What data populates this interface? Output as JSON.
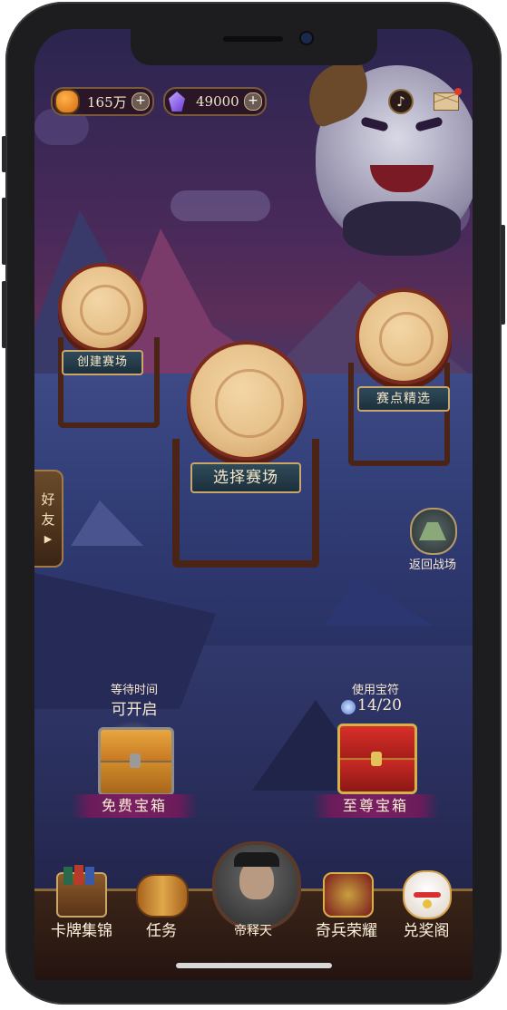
{
  "resources": {
    "coins": "165万",
    "gems": "49000"
  },
  "drums": {
    "create_label": "创建赛场",
    "select_label": "选择赛场",
    "featured_label": "赛点精选"
  },
  "side": {
    "friend_label": "好友",
    "friend_arrow": "▶",
    "return_label": "返回战场"
  },
  "free_chest": {
    "wait_label": "等待时间",
    "status": "可开启",
    "name": "免费宝箱"
  },
  "premium_chest": {
    "use_label": "使用宝符",
    "count": "14/20",
    "name": "至尊宝箱"
  },
  "nav": {
    "items": [
      {
        "label": "卡牌集锦"
      },
      {
        "label": "任务"
      },
      {
        "label": "帝释天"
      },
      {
        "label": "奇兵荣耀"
      },
      {
        "label": "兑奖阁"
      }
    ]
  },
  "icons": {
    "plus": "+",
    "music": "♪",
    "mail_dot_color": "#e23b2b"
  },
  "colors": {
    "accent_gold": "#c9a66a",
    "ribbon": "#7a1f63",
    "plaque": "#2f4a5a"
  }
}
